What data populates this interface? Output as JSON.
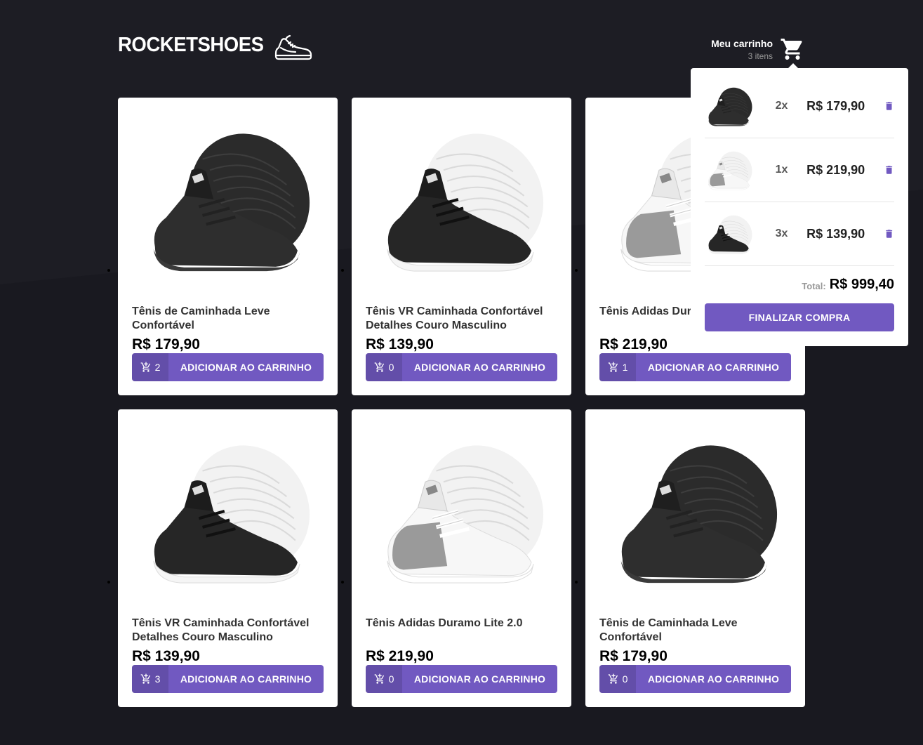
{
  "brand": {
    "name": "ROCKETSHOES"
  },
  "cart": {
    "title": "Meu carrinho",
    "count": "3 itens"
  },
  "products": [
    {
      "title": "Tênis de Caminhada Leve Confortável",
      "price": "R$ 179,90",
      "amount": "2",
      "button": "ADICIONAR AO CARRINHO",
      "variant": "black"
    },
    {
      "title": "Tênis VR Caminhada Confortável Detalhes Couro Masculino",
      "price": "R$ 139,90",
      "amount": "0",
      "button": "ADICIONAR AO CARRINHO",
      "variant": "blackwhite"
    },
    {
      "title": "Tênis Adidas Duramo Lite 2.0",
      "price": "R$ 219,90",
      "amount": "1",
      "button": "ADICIONAR AO CARRINHO",
      "variant": "white"
    },
    {
      "title": "Tênis VR Caminhada Confortável Detalhes Couro Masculino",
      "price": "R$ 139,90",
      "amount": "3",
      "button": "ADICIONAR AO CARRINHO",
      "variant": "blackwhite"
    },
    {
      "title": "Tênis Adidas Duramo Lite 2.0",
      "price": "R$ 219,90",
      "amount": "0",
      "button": "ADICIONAR AO CARRINHO",
      "variant": "white"
    },
    {
      "title": "Tênis de Caminhada Leve Confortável",
      "price": "R$ 179,90",
      "amount": "0",
      "button": "ADICIONAR AO CARRINHO",
      "variant": "black"
    }
  ],
  "dropdown": {
    "items": [
      {
        "qty": "2x",
        "price": "R$ 179,90",
        "variant": "black"
      },
      {
        "qty": "1x",
        "price": "R$ 219,90",
        "variant": "white"
      },
      {
        "qty": "3x",
        "price": "R$ 139,90",
        "variant": "blackwhite"
      }
    ],
    "total_label": "Total:",
    "total_value": "R$ 999,40",
    "checkout": "FINALIZAR COMPRA"
  },
  "colors": {
    "accent": "#7159c1",
    "background": "#191920"
  }
}
